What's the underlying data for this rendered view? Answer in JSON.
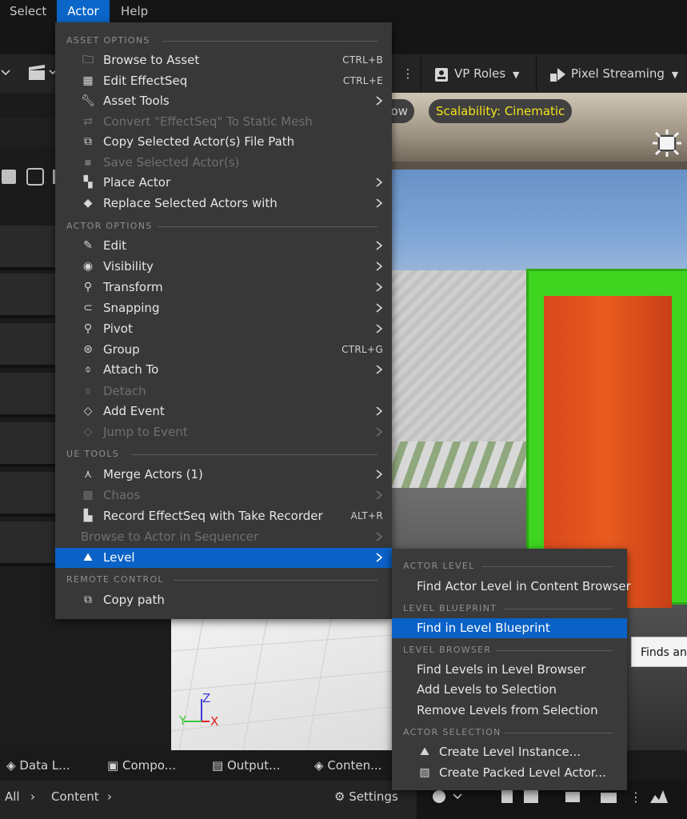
{
  "menubar": {
    "items": [
      {
        "label": "Select"
      },
      {
        "label": "Actor"
      },
      {
        "label": "Help"
      }
    ]
  },
  "toolbar": {
    "vp_roles": "VP Roles",
    "pixel_streaming": "Pixel Streaming",
    "scalability": "Scalability: Cinematic",
    "overflow_pill": "ow"
  },
  "actor_menu": {
    "sections": {
      "asset_options": "ASSET OPTIONS",
      "actor_options": "ACTOR OPTIONS",
      "ue_tools": "UE TOOLS",
      "remote_control": "REMOTE CONTROL"
    },
    "items": {
      "browse_to_asset": {
        "label": "Browse to Asset",
        "shortcut": "CTRL+B"
      },
      "edit_effectseq": {
        "label": "Edit EffectSeq",
        "shortcut": "CTRL+E"
      },
      "asset_tools": {
        "label": "Asset Tools"
      },
      "convert_static_mesh": {
        "label": "Convert \"EffectSeq\" To Static Mesh"
      },
      "copy_file_path": {
        "label": "Copy Selected Actor(s) File Path"
      },
      "save_selected": {
        "label": "Save Selected Actor(s)"
      },
      "place_actor": {
        "label": "Place Actor"
      },
      "replace_selected": {
        "label": "Replace Selected Actors with"
      },
      "edit": {
        "label": "Edit"
      },
      "visibility": {
        "label": "Visibility"
      },
      "transform": {
        "label": "Transform"
      },
      "snapping": {
        "label": "Snapping"
      },
      "pivot": {
        "label": "Pivot"
      },
      "group": {
        "label": "Group",
        "shortcut": "CTRL+G"
      },
      "attach_to": {
        "label": "Attach To"
      },
      "detach": {
        "label": "Detach"
      },
      "add_event": {
        "label": "Add Event"
      },
      "jump_to_event": {
        "label": "Jump to Event"
      },
      "merge_actors": {
        "label": "Merge Actors (1)"
      },
      "chaos": {
        "label": "Chaos"
      },
      "record_effectseq": {
        "label": "Record EffectSeq with Take Recorder",
        "shortcut": "ALT+R"
      },
      "browse_to_actor_sequencer": {
        "label": "Browse to Actor in Sequencer"
      },
      "level": {
        "label": "Level"
      },
      "copy_path": {
        "label": "Copy path"
      }
    }
  },
  "level_submenu": {
    "sections": {
      "actor_level": "ACTOR LEVEL",
      "level_blueprint": "LEVEL BLUEPRINT",
      "level_browser": "LEVEL BROWSER",
      "actor_selection": "ACTOR SELECTION"
    },
    "items": {
      "find_actor_level": "Find Actor Level in Content Browser",
      "find_in_level_blueprint": "Find in Level Blueprint",
      "find_levels_in_browser": "Find Levels in Level Browser",
      "add_levels_to_selection": "Add Levels to Selection",
      "remove_levels_from_selection": "Remove Levels from Selection",
      "create_level_instance": "Create Level Instance...",
      "create_packed_level_actor": "Create Packed Level Actor..."
    }
  },
  "tooltip": {
    "text": "Finds any"
  },
  "gizmo": {
    "z": "Z",
    "y": "Y",
    "x": "X"
  },
  "bottom_tabs": [
    "Data L...",
    "Compo...",
    "Output...",
    "Conten..."
  ],
  "path_bar": {
    "all": "All",
    "content": "Content",
    "settings": "Settings"
  },
  "colors": {
    "accent": "#0a66c9",
    "highlight": "#0a62c7",
    "scalability_text": "#f3e21c",
    "door_frame": "#3ed41f",
    "door": "#e0511e"
  }
}
